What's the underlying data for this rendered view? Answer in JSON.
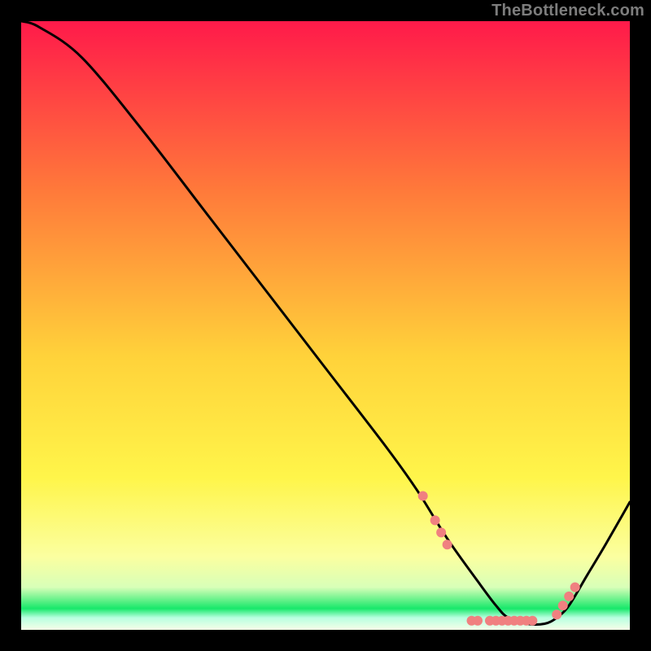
{
  "watermark": "TheBottleneck.com",
  "colors": {
    "top": "#ff1a4a",
    "mid_upper": "#ff8a3a",
    "mid": "#ffe13a",
    "mid_lower": "#ffff66",
    "pale": "#f6ffb0",
    "bottom": "#17e86a",
    "curve": "#000000",
    "dot": "#f08080",
    "frame": "#000000"
  },
  "chart_data": {
    "type": "line",
    "title": "",
    "xlabel": "",
    "ylabel": "",
    "xlim": [
      0,
      100
    ],
    "ylim": [
      0,
      100
    ],
    "series": [
      {
        "name": "curve",
        "x": [
          0,
          3,
          10,
          20,
          30,
          40,
          50,
          60,
          65,
          70,
          75,
          78,
          80,
          83,
          86,
          88,
          90,
          93,
          96,
          100
        ],
        "y": [
          100,
          99,
          94,
          82,
          69,
          56,
          43,
          30,
          23,
          15,
          8,
          4,
          2,
          1,
          1,
          2,
          4,
          9,
          14,
          21
        ]
      }
    ],
    "markers": {
      "series": "curve",
      "points": [
        {
          "x": 66,
          "y": 22
        },
        {
          "x": 68,
          "y": 18
        },
        {
          "x": 69,
          "y": 16
        },
        {
          "x": 70,
          "y": 14
        },
        {
          "x": 74,
          "y": 1.5
        },
        {
          "x": 75,
          "y": 1.5
        },
        {
          "x": 77,
          "y": 1.5
        },
        {
          "x": 78,
          "y": 1.5
        },
        {
          "x": 79,
          "y": 1.5
        },
        {
          "x": 80,
          "y": 1.5
        },
        {
          "x": 81,
          "y": 1.5
        },
        {
          "x": 82,
          "y": 1.5
        },
        {
          "x": 83,
          "y": 1.5
        },
        {
          "x": 84,
          "y": 1.5
        },
        {
          "x": 88,
          "y": 2.5
        },
        {
          "x": 89,
          "y": 4
        },
        {
          "x": 90,
          "y": 5.5
        },
        {
          "x": 91,
          "y": 7
        }
      ]
    }
  }
}
